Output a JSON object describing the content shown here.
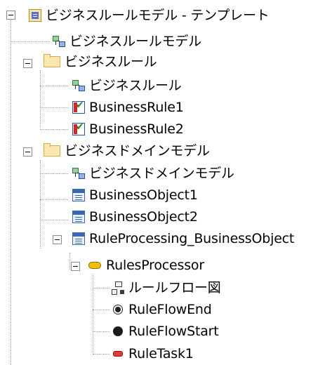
{
  "tree": {
    "root": {
      "label": "ビジネスルールモデル - テンプレート",
      "icon": "package-icon",
      "expanded": true
    },
    "root_diagram": {
      "label": "ビジネスルールモデル",
      "icon": "diagram-icon"
    },
    "rules_folder": {
      "label": "ビジネスルール",
      "icon": "folder-icon",
      "expanded": true
    },
    "rules_diagram": {
      "label": "ビジネスルール",
      "icon": "diagram-icon"
    },
    "rule1": {
      "label": "BusinessRule1",
      "icon": "business-rule-icon"
    },
    "rule2": {
      "label": "BusinessRule2",
      "icon": "business-rule-icon"
    },
    "domain_folder": {
      "label": "ビジネスドメインモデル",
      "icon": "folder-icon",
      "expanded": true
    },
    "domain_diagram": {
      "label": "ビジネスドメインモデル",
      "icon": "diagram-icon"
    },
    "object1": {
      "label": "BusinessObject1",
      "icon": "class-icon"
    },
    "object2": {
      "label": "BusinessObject2",
      "icon": "class-icon"
    },
    "processing": {
      "label": "RuleProcessing_BusinessObject",
      "icon": "class-icon",
      "expanded": true
    },
    "processor": {
      "label": "RulesProcessor",
      "icon": "component-icon",
      "expanded": true
    },
    "flow_diagram": {
      "label": "ルールフロー図",
      "icon": "flow-diagram-icon"
    },
    "flow_end": {
      "label": "RuleFlowEnd",
      "icon": "final-node-icon"
    },
    "flow_start": {
      "label": "RuleFlowStart",
      "icon": "initial-node-icon"
    },
    "task1": {
      "label": "RuleTask1",
      "icon": "rule-task-icon"
    }
  },
  "colors": {
    "background": "#ffffff",
    "connector": "#9a9a9a",
    "text": "#000000"
  }
}
